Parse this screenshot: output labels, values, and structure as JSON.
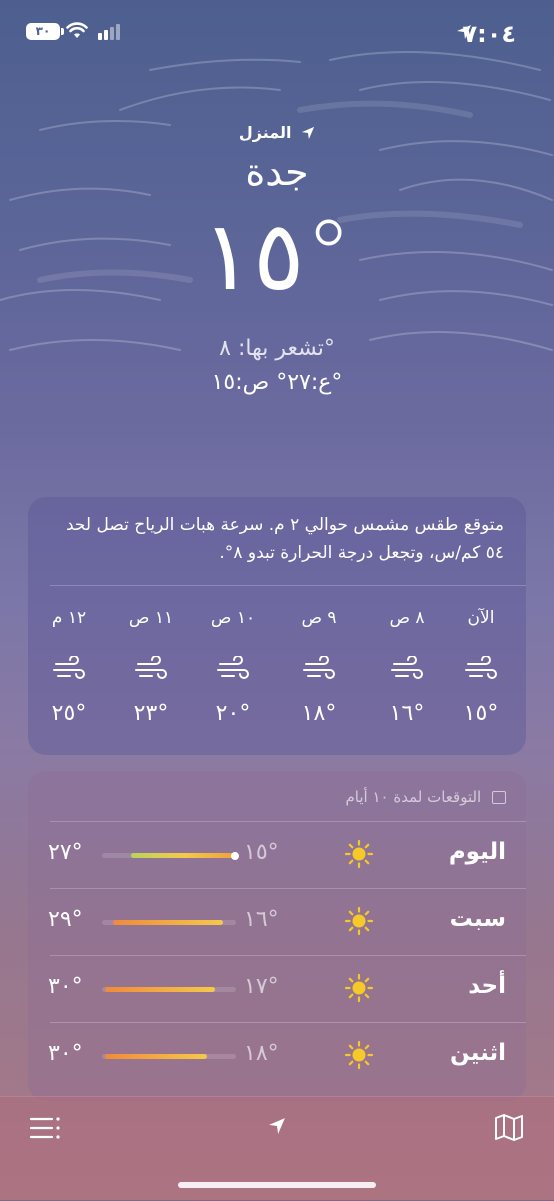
{
  "status_bar": {
    "time": "٧:٠٤",
    "battery": "٣٠"
  },
  "header": {
    "location_label": "المنزل",
    "city": "جدة",
    "temperature": "١٥°",
    "feels_like": "تشعر بها: ٨°",
    "high_low": "ع:٢٧°  ص:١٥°"
  },
  "hourly": {
    "summary": "متوقع طقس مشمس حوالي ٢ م. سرعة هبات الرياح تصل لحد ٥٤ كم/س، وتجعل درجة الحرارة تبدو ٨°.",
    "items": [
      {
        "label": "الآن",
        "icon": "wind-icon",
        "temp": "١٥°"
      },
      {
        "label": "٨ ص",
        "icon": "wind-icon",
        "temp": "١٦°"
      },
      {
        "label": "٩ ص",
        "icon": "wind-icon",
        "temp": "١٨°"
      },
      {
        "label": "١٠ ص",
        "icon": "wind-icon",
        "temp": "٢٠°"
      },
      {
        "label": "١١ ص",
        "icon": "wind-icon",
        "temp": "٢٣°"
      },
      {
        "label": "١٢ م",
        "icon": "wind-icon",
        "temp": "٢٥°"
      }
    ]
  },
  "daily": {
    "title": "التوقعات لمدة ١٠ أيام",
    "rows": [
      {
        "day": "اليوم",
        "icon": "sun-icon",
        "low": "١٥°",
        "high": "٢٧°",
        "range_start": 0.0,
        "range_end": 0.78,
        "current": 0.0
      },
      {
        "day": "سبت",
        "icon": "sun-icon",
        "low": "١٦°",
        "high": "٢٩°",
        "range_start": 0.1,
        "range_end": 0.92
      },
      {
        "day": "أحد",
        "icon": "sun-icon",
        "low": "١٧°",
        "high": "٣٠°",
        "range_start": 0.16,
        "range_end": 0.98
      },
      {
        "day": "اثنين",
        "icon": "sun-icon",
        "low": "١٨°",
        "high": "٣٠°",
        "range_start": 0.22,
        "range_end": 0.98
      }
    ]
  },
  "toolbar": {
    "left_icon": "list-icon",
    "center_icon": "location-arrow-icon",
    "right_icon": "map-icon"
  }
}
